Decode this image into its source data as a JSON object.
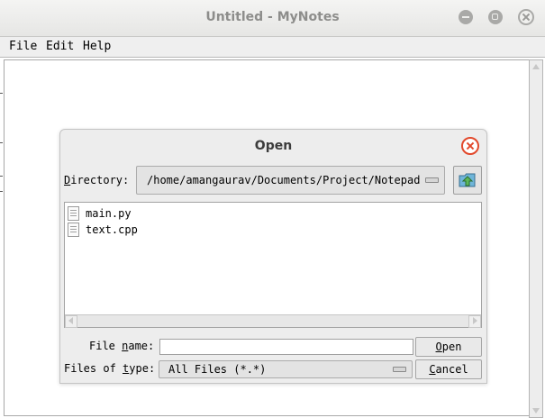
{
  "window": {
    "title": "Untitled - MyNotes",
    "controls": {
      "minimize": "minimize-icon",
      "maximize": "maximize-icon",
      "close": "close-icon"
    }
  },
  "menubar": {
    "items": [
      "File",
      "Edit",
      "Help"
    ]
  },
  "dialog": {
    "title": "Open",
    "directory": {
      "label_underlined": "D",
      "label_rest": "irectory:",
      "value": "/home/amangaurav/Documents/Project/Notepad"
    },
    "files": [
      {
        "name": "main.py",
        "icon": "file-icon"
      },
      {
        "name": "text.cpp",
        "icon": "file-icon"
      }
    ],
    "file_name": {
      "label_pre": "File ",
      "label_underlined": "n",
      "label_post": "ame:",
      "value": ""
    },
    "file_type": {
      "label_pre": "Files of ",
      "label_underlined": "t",
      "label_post": "ype:",
      "value": "All Files (*.*)"
    },
    "buttons": {
      "open_underlined": "O",
      "open_rest": "pen",
      "cancel_underlined": "C",
      "cancel_rest": "ancel"
    }
  },
  "colors": {
    "title_text": "#8d8d8b",
    "dialog_close": "#e2492c",
    "up_folder_icon": "#3d8f3a",
    "dialog_bg": "#ededed"
  }
}
